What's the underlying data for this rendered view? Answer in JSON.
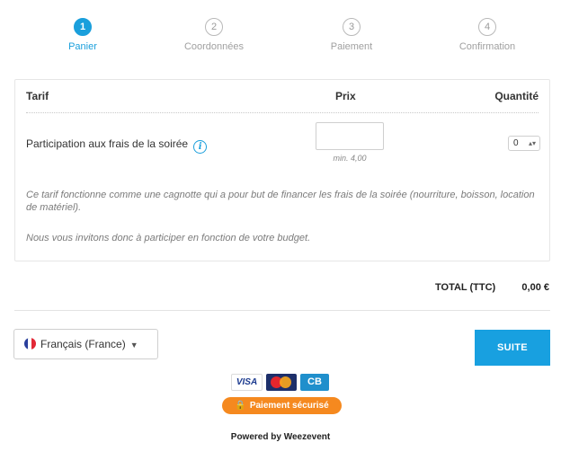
{
  "steps": [
    {
      "number": "1",
      "label": "Panier",
      "active": true
    },
    {
      "number": "2",
      "label": "Coordonnées",
      "active": false
    },
    {
      "number": "3",
      "label": "Paiement",
      "active": false
    },
    {
      "number": "4",
      "label": "Confirmation",
      "active": false
    }
  ],
  "table": {
    "headers": {
      "tarif": "Tarif",
      "prix": "Prix",
      "quantite": "Quantité"
    },
    "row": {
      "label": "Participation aux frais de la soirée",
      "info_icon": "info-icon",
      "price_value": "",
      "price_min": "min. 4,00",
      "quantity": "0"
    },
    "description_1": "Ce tarif fonctionne comme une cagnotte qui a pour but de financer les frais de la soirée (nourriture, boisson, location de matériel).",
    "description_2": "Nous vous invitons donc à participer en fonction de votre budget."
  },
  "total": {
    "label": "TOTAL (TTC)",
    "value": "0,00 €"
  },
  "language": {
    "label": "Français (France)"
  },
  "actions": {
    "next_label": "SUITE"
  },
  "payment": {
    "visa": "VISA",
    "cb": "CB",
    "secure_label": "Paiement sécurisé"
  },
  "footer": {
    "powered": "Powered by Weezevent"
  },
  "colors": {
    "accent": "#1a9fdc",
    "secure": "#f5891f"
  }
}
